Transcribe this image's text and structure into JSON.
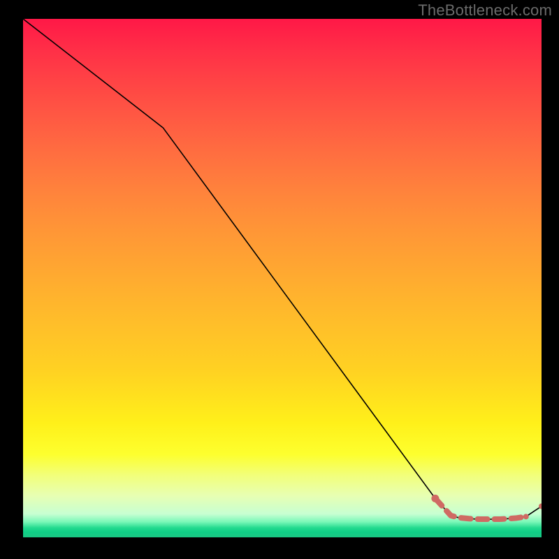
{
  "watermark": "TheBottleneck.com",
  "chart_data": {
    "type": "line",
    "title": "",
    "xlabel": "",
    "ylabel": "",
    "xlim": [
      0,
      100
    ],
    "ylim": [
      0,
      100
    ],
    "grid": false,
    "series": [
      {
        "name": "main-curve",
        "style": "solid-thin-black",
        "x": [
          0,
          27,
          79.5,
          82.5,
          84,
          86,
          88,
          90,
          92,
          93.5,
          95,
          97,
          100
        ],
        "values": [
          100,
          79,
          7.5,
          4.2,
          3.8,
          3.6,
          3.5,
          3.5,
          3.5,
          3.6,
          3.7,
          4.0,
          6.0
        ]
      },
      {
        "name": "highlight-segment",
        "style": "thick-dashed-salmon",
        "x": [
          79.5,
          82.5,
          84,
          86,
          88,
          90,
          92,
          93.5,
          95,
          97
        ],
        "values": [
          7.5,
          4.2,
          3.8,
          3.6,
          3.5,
          3.5,
          3.5,
          3.6,
          3.7,
          4.0
        ]
      },
      {
        "name": "end-marker",
        "style": "dot-salmon",
        "x": [
          97,
          100
        ],
        "values": [
          4.0,
          6.0
        ]
      }
    ],
    "colors": {
      "curve": "#000000",
      "highlight": "#cf6a63",
      "background_top": "#ff1847",
      "background_mid": "#ffd222",
      "background_bottom": "#1bc784"
    }
  }
}
